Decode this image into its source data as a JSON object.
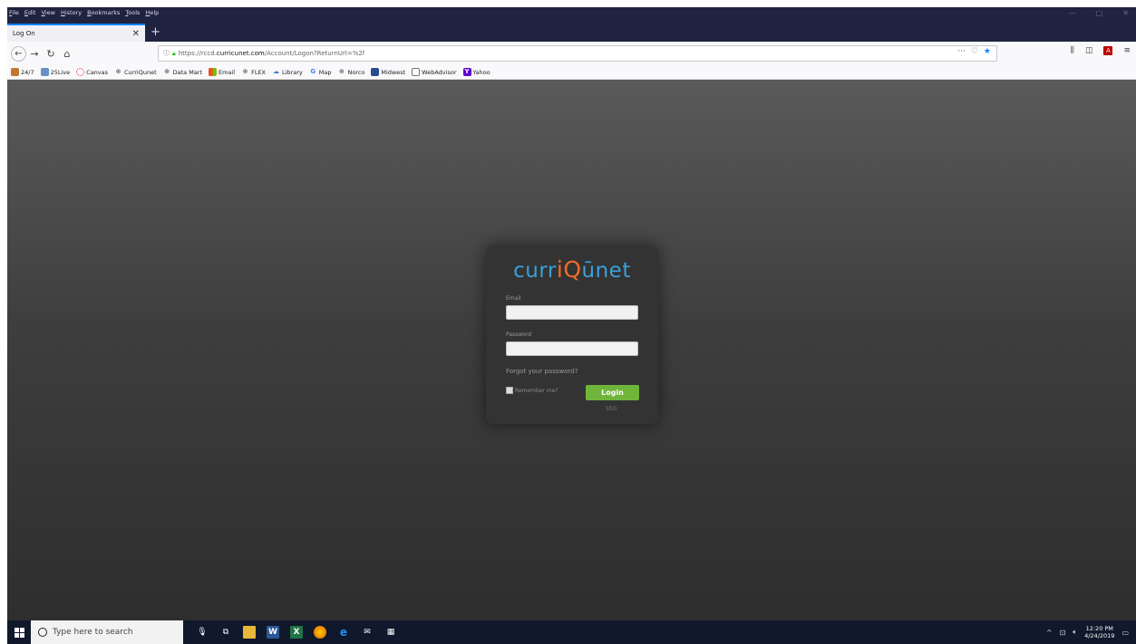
{
  "browser": {
    "menu": [
      "File",
      "Edit",
      "View",
      "History",
      "Bookmarks",
      "Tools",
      "Help"
    ],
    "window_controls": [
      "—",
      "▢",
      "✕"
    ],
    "tab_title": "Log On",
    "new_tab": "+",
    "url_prefix": "https://rccd.",
    "url_host": "curricunet.com",
    "url_path": "/Account/Logon?ReturnUrl=%2f",
    "url_more": "···",
    "bookmarks": [
      "24/7",
      "25Live",
      "Canvas",
      "CurriQunet",
      "Data Mart",
      "Email",
      "FLEX",
      "Library",
      "Map",
      "Norco",
      "Midwest",
      "WebAdvisor",
      "Yahoo"
    ]
  },
  "login": {
    "logo_left": "curr",
    "logo_accent": "iQ",
    "logo_right": "ūnet",
    "email_label": "Email",
    "password_label": "Password",
    "forgot_link": "Forgot your password?",
    "remember_label": "Remember me?",
    "login_button": "Login",
    "sso_link": "SSO"
  },
  "taskbar": {
    "search_placeholder": "Type here to search",
    "time": "12:20 PM",
    "date": "4/24/2019"
  },
  "colors": {
    "accent_blue": "#3aa0d8",
    "accent_orange": "#f06b2a",
    "login_green": "#6fb53a"
  }
}
